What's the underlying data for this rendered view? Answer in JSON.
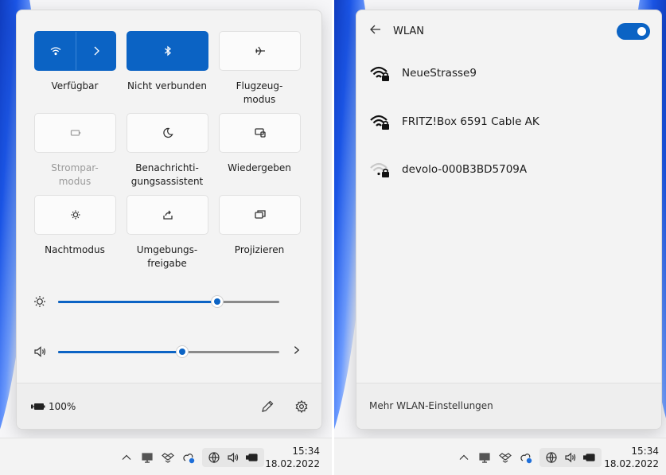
{
  "quick_settings": {
    "tiles": [
      {
        "label": "Verfügbar",
        "state": "on",
        "icon": "wifi-icon"
      },
      {
        "label": "Nicht verbunden",
        "state": "on",
        "icon": "bluetooth-icon"
      },
      {
        "label": "Flugzeug-\nmodus",
        "state": "off",
        "icon": "airplane-icon"
      },
      {
        "label": "Strompar-\nmodus",
        "state": "disabled",
        "icon": "battery-saver-icon"
      },
      {
        "label": "Benachrichti-\ngungsassistent",
        "state": "off",
        "icon": "moon-icon"
      },
      {
        "label": "Wiedergeben",
        "state": "off",
        "icon": "cast-icon"
      },
      {
        "label": "Nachtmodus",
        "state": "off",
        "icon": "night-light-icon"
      },
      {
        "label": "Umgebungs-\nfreigabe",
        "state": "off",
        "icon": "share-icon"
      },
      {
        "label": "Projizieren",
        "state": "off",
        "icon": "project-icon"
      }
    ],
    "brightness": {
      "value": 0.72,
      "icon": "brightness-icon"
    },
    "volume": {
      "value": 0.56,
      "icon": "speaker-icon"
    },
    "battery_text": "100%"
  },
  "wlan": {
    "title": "WLAN",
    "enabled": true,
    "networks": [
      {
        "name": "NeueStrasse9",
        "strength": "strong",
        "secured": true
      },
      {
        "name": "FRITZ!Box 6591 Cable AK",
        "strength": "strong",
        "secured": true
      },
      {
        "name": "devolo-000B3BD5709A",
        "strength": "weak",
        "secured": true
      }
    ],
    "more_settings": "Mehr WLAN-Einstellungen"
  },
  "taskbar": {
    "time": "15:34",
    "date": "18.02.2022"
  },
  "colors": {
    "accent": "#0b63c4",
    "panel": "#f3f3f3"
  }
}
